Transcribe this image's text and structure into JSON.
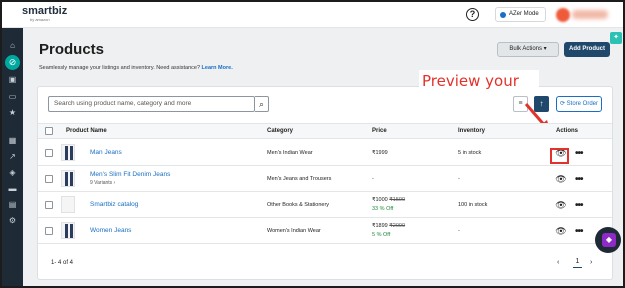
{
  "header": {
    "logo_text": "smartbiz",
    "logo_sub": "by amazon",
    "help_icon": "?",
    "mode_label": "AZer Mode",
    "user_avatar": "avatar"
  },
  "sidebar": {
    "icons": [
      "home-icon",
      "store-icon",
      "clipboard-icon",
      "inbox-icon",
      "star-icon",
      "warehouse-icon",
      "chart-icon",
      "tag-icon",
      "chat-icon",
      "settings-icon",
      "gear-icon"
    ]
  },
  "page": {
    "title": "Products",
    "subtitle": "Seamlessly manage your listings and inventory. Need assistance?",
    "learn_more": "Learn More.",
    "bulk_actions": "Bulk Actions",
    "add_product": "Add Product"
  },
  "toolbar": {
    "search_placeholder": "Search using product name, category and more",
    "store_order": "Store Order"
  },
  "annotation": {
    "text": "Preview your",
    "color": "#e2322b"
  },
  "table": {
    "headers": {
      "product_name": "Product Name",
      "category": "Category",
      "price": "Price",
      "inventory": "Inventory",
      "actions": "Actions"
    },
    "rows": [
      {
        "name": "Man Jeans",
        "variants": "",
        "category": "Men's Indian Wear",
        "price": "₹1999",
        "original_price": "",
        "discount": "",
        "inventory": "5 in stock"
      },
      {
        "name": "Men's Slim Fit Denim Jeans",
        "variants": "9 Variants",
        "category": "Men's Jeans and Trousers",
        "price": "-",
        "original_price": "",
        "discount": "",
        "inventory": "-"
      },
      {
        "name": "Smartbiz catalog",
        "variants": "",
        "category": "Other Books & Stationery",
        "price": "₹1000",
        "original_price": "₹1500",
        "discount": "33 % Off",
        "inventory": "100 in stock"
      },
      {
        "name": "Women Jeans",
        "variants": "",
        "category": "Women's Indian Wear",
        "price": "₹1899",
        "original_price": "₹2000",
        "discount": "5 % Off",
        "inventory": "-"
      }
    ]
  },
  "pagination": {
    "range": "1- 4 of 4",
    "current": "1",
    "prev": "‹",
    "next": "›"
  },
  "colors": {
    "sidebar": "#1e2a36",
    "accent": "#00a9a0",
    "primary": "#20486b",
    "link": "#1a6fc4",
    "discount": "#1f8a3c"
  }
}
